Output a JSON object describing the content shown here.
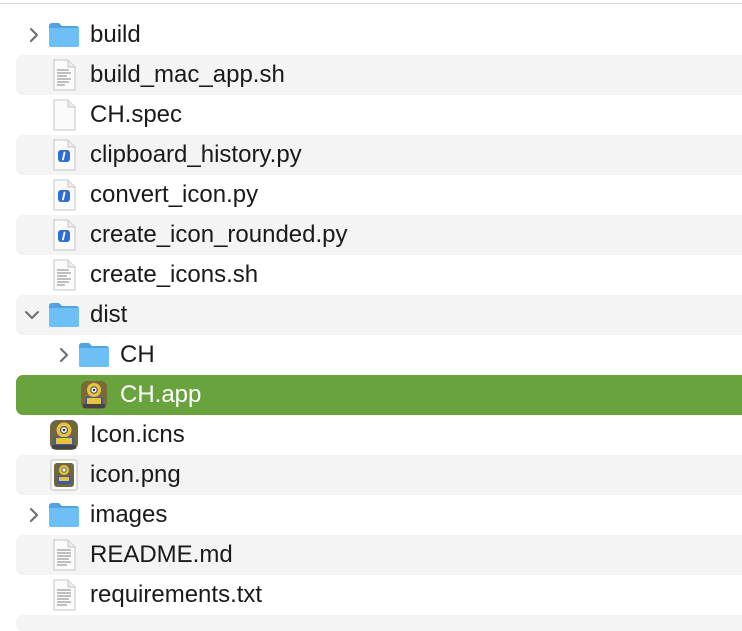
{
  "file_list": {
    "rows": [
      {
        "name": "build",
        "kind": "folder",
        "level": 0,
        "disclosure": "collapsed"
      },
      {
        "name": "build_mac_app.sh",
        "kind": "script",
        "level": 0,
        "disclosure": "none"
      },
      {
        "name": "CH.spec",
        "kind": "blank",
        "level": 0,
        "disclosure": "none"
      },
      {
        "name": "clipboard_history.py",
        "kind": "python",
        "level": 0,
        "disclosure": "none"
      },
      {
        "name": "convert_icon.py",
        "kind": "python",
        "level": 0,
        "disclosure": "none"
      },
      {
        "name": "create_icon_rounded.py",
        "kind": "python",
        "level": 0,
        "disclosure": "none"
      },
      {
        "name": "create_icons.sh",
        "kind": "script",
        "level": 0,
        "disclosure": "none"
      },
      {
        "name": "dist",
        "kind": "folder",
        "level": 0,
        "disclosure": "expanded"
      },
      {
        "name": "CH",
        "kind": "folder",
        "level": 1,
        "disclosure": "collapsed"
      },
      {
        "name": "CH.app",
        "kind": "app",
        "level": 1,
        "disclosure": "none",
        "selected": true
      },
      {
        "name": "Icon.icns",
        "kind": "app-icon",
        "level": 0,
        "disclosure": "none"
      },
      {
        "name": "icon.png",
        "kind": "image",
        "level": 0,
        "disclosure": "none"
      },
      {
        "name": "images",
        "kind": "folder",
        "level": 0,
        "disclosure": "collapsed"
      },
      {
        "name": "README.md",
        "kind": "text",
        "level": 0,
        "disclosure": "none"
      },
      {
        "name": "requirements.txt",
        "kind": "text",
        "level": 0,
        "disclosure": "none"
      }
    ]
  },
  "colors": {
    "selection": "#69a33d",
    "folder": "#5eb3ee",
    "alternate_row": "#f4f4f4"
  }
}
